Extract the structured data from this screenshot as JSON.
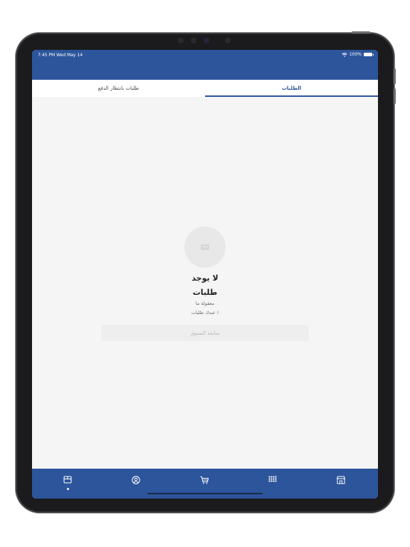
{
  "status_bar": {
    "time_date": "7:45 PM  Wed May 14",
    "battery": "100%",
    "wifi_icon": "wifi-icon",
    "battery_icon": "battery-icon"
  },
  "tabs": [
    {
      "label": "الطلبات",
      "selected": true
    },
    {
      "label": "طلبات بانتظار الدفع",
      "selected": false
    }
  ],
  "empty_state": {
    "icon": "cart-icon",
    "title_line1": "لا يوجد",
    "title_line2": "طلبات",
    "subtitle_line1": "معقولة ما",
    "subtitle_line2": "عندك طلبات !",
    "button_label": "متابعة التسوق"
  },
  "bottom_nav": [
    {
      "icon": "orders-box-icon",
      "active": true
    },
    {
      "icon": "account-icon",
      "active": false
    },
    {
      "icon": "cart-icon",
      "active": false
    },
    {
      "icon": "grid-menu-icon",
      "active": false
    },
    {
      "icon": "store-icon",
      "active": false
    }
  ],
  "colors": {
    "brand": "#2c559b",
    "background": "#f5f5f5",
    "button_bg": "#eeeeee"
  }
}
